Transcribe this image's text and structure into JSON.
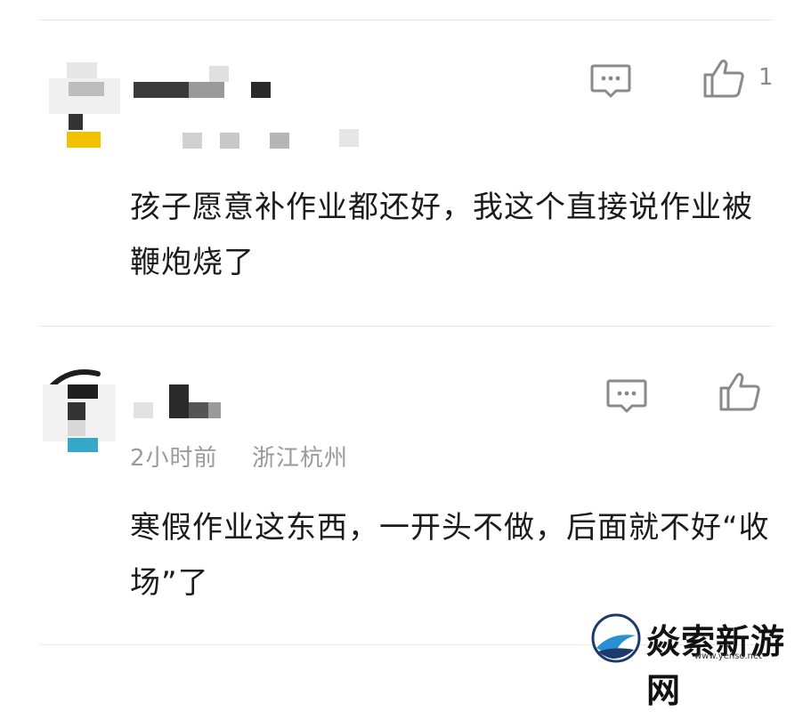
{
  "comments": [
    {
      "location_text": "",
      "text": "孩子愿意补作业都还好，我这个直接说作业被鞭炮烧了",
      "like_count": "1",
      "reply_icon": "comment-bubble-icon",
      "like_icon": "thumbs-up-icon"
    },
    {
      "time": "2小时前",
      "location": "浙江杭州",
      "text": "寒假作业这东西，一开头不做，后面就不好“收场”了",
      "like_count": "",
      "reply_icon": "comment-bubble-icon",
      "like_icon": "thumbs-up-icon"
    }
  ],
  "watermark": {
    "brand": "焱索新游网",
    "url": "www.yenso.net"
  },
  "colors": {
    "text": "#1b1b1b",
    "meta": "#9a9a9a",
    "icon": "#8a8a8a",
    "divider": "#e8e8e8"
  }
}
